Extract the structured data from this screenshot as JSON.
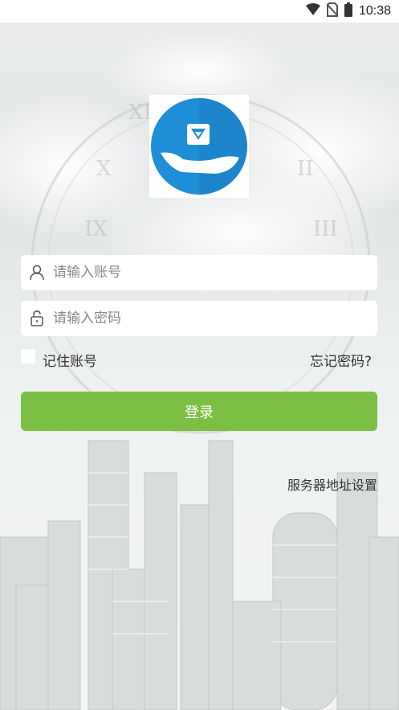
{
  "status_bar": {
    "time": "10:38",
    "icons": [
      "wifi-icon",
      "no-sim-icon",
      "battery-icon"
    ]
  },
  "logo": {
    "icon": "hand-holding-cube-logo",
    "color": "#1e8fd6"
  },
  "login": {
    "username_placeholder": "请输入账号",
    "password_placeholder": "请输入密码",
    "remember_label": "记住账号",
    "forgot_label": "忘记密码?",
    "login_button": "登录",
    "server_settings": "服务器地址设置"
  },
  "colors": {
    "accent": "#7bbf44",
    "logo_blue": "#1e8fd6"
  }
}
